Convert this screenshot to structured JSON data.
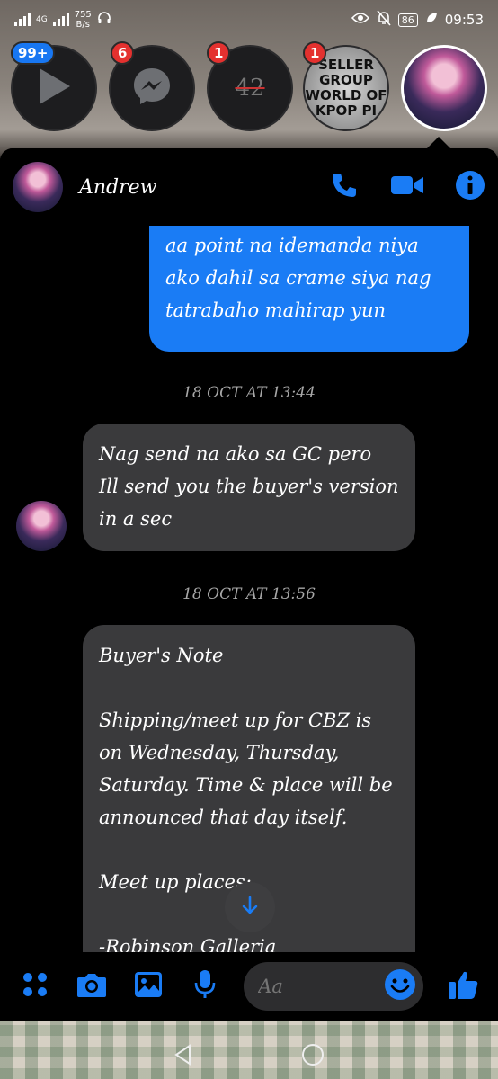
{
  "status_bar": {
    "network": "4G",
    "speed_value": "755",
    "speed_unit": "B/s",
    "battery": "86",
    "time": "09:53"
  },
  "chat_heads": [
    {
      "name": "video-app",
      "badge": "99+",
      "badge_color": "#1877f2"
    },
    {
      "name": "messenger",
      "badge": "6",
      "badge_color": "#e4312f"
    },
    {
      "name": "number-42",
      "badge": "1",
      "badge_color": "#e4312f",
      "label": "42"
    },
    {
      "name": "seller-group",
      "badge": "1",
      "badge_color": "#e4312f",
      "label_lines": [
        "SELLER",
        "GROUP",
        "WORLD OF",
        "KPOP PI"
      ]
    },
    {
      "name": "andrew",
      "badge": ""
    }
  ],
  "chat": {
    "contact_name": "Andrew",
    "accent": "#1a7cf5",
    "messages": [
      {
        "type": "outgoing",
        "text": "aa point na idemanda niya\nako dahil sa crame siya nag\ntatrabaho mahirap yun"
      },
      {
        "type": "timestamp",
        "text": "18 OCT AT 13:44"
      },
      {
        "type": "incoming",
        "text": "Nag send na ako sa GC pero\nIll send you the buyer's version\nin a sec"
      },
      {
        "type": "timestamp",
        "text": "18 OCT AT 13:56"
      },
      {
        "type": "incoming",
        "text": "Buyer's Note\n\nShipping/meet up for CBZ is\non Wednesday, Thursday,\nSaturday. Time & place will be\nannounced that day itself.\n\nMeet up places:\n\n-Robinson Galleria"
      }
    ]
  },
  "composer": {
    "placeholder": "Aa"
  }
}
